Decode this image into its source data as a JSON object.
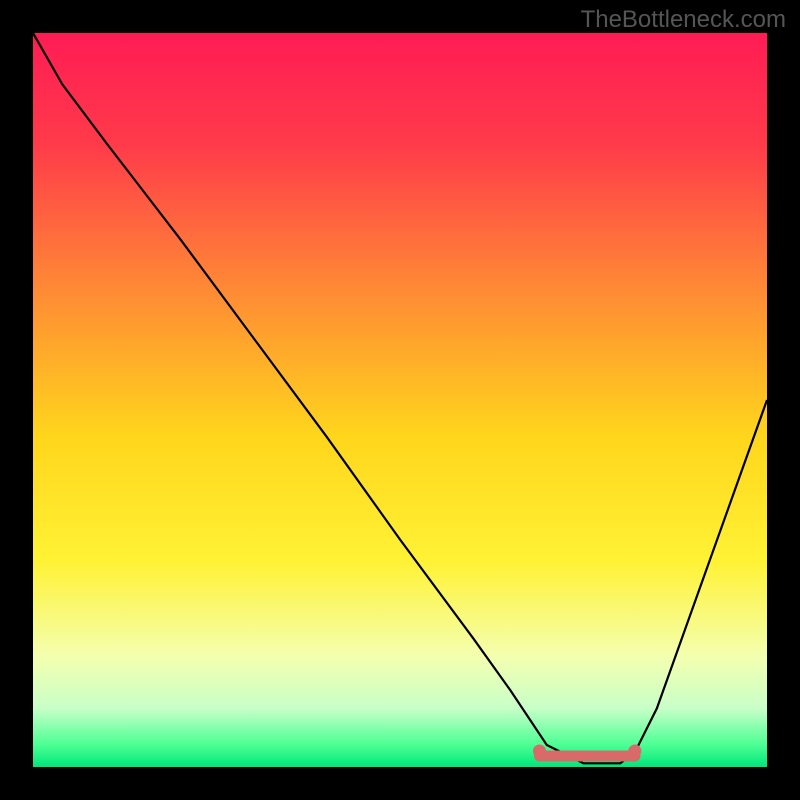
{
  "watermark": "TheBottleneck.com",
  "chart_data": {
    "type": "line",
    "title": "",
    "xlabel": "",
    "ylabel": "",
    "xlim": [
      0,
      100
    ],
    "ylim": [
      0,
      100
    ],
    "curve": {
      "description": "V-shaped black performance curve over rainbow gradient; descends from upper left, flat minimum band near x≈70–82, rises toward right",
      "x": [
        0,
        4,
        10,
        20,
        30,
        40,
        50,
        60,
        65,
        70,
        75,
        80,
        82,
        85,
        90,
        95,
        100
      ],
      "y": [
        100,
        93,
        85,
        72,
        58.5,
        45,
        31,
        17.5,
        10.5,
        3,
        0.5,
        0.5,
        2,
        8,
        22,
        36,
        50
      ],
      "minimum_band_x": [
        69,
        82
      ],
      "minimum_band_y": 1.5,
      "marker_points_x": [
        69,
        82
      ]
    },
    "gradient_stops": [
      {
        "offset": 0.0,
        "color": "#ff1c55"
      },
      {
        "offset": 0.15,
        "color": "#ff3a4a"
      },
      {
        "offset": 0.35,
        "color": "#ff8a35"
      },
      {
        "offset": 0.55,
        "color": "#ffd61c"
      },
      {
        "offset": 0.72,
        "color": "#fff235"
      },
      {
        "offset": 0.85,
        "color": "#f4ffb0"
      },
      {
        "offset": 0.92,
        "color": "#c8ffc8"
      },
      {
        "offset": 0.97,
        "color": "#4cff94"
      },
      {
        "offset": 1.0,
        "color": "#00e67a"
      }
    ],
    "marker_color": "#d86a6a",
    "curve_color": "#000000",
    "band_stroke_width": 11
  }
}
